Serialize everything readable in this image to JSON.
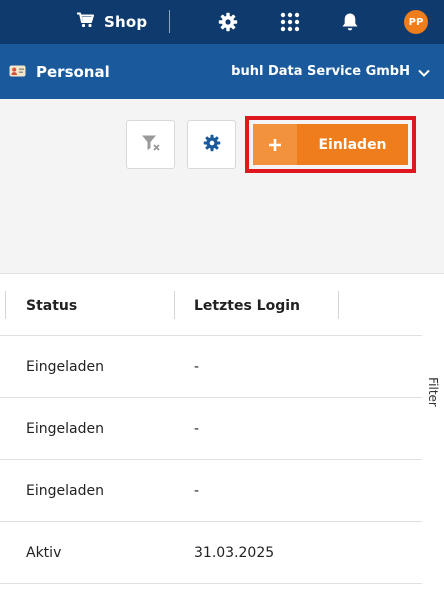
{
  "topbar": {
    "shop_label": "Shop",
    "user_initials": "PP",
    "avatar_color": "#f07d1b",
    "background": "#0e3a6e"
  },
  "subbar": {
    "title": "Personal",
    "company": "buhl Data Service GmbH",
    "background": "#1a5a9c"
  },
  "toolbar": {
    "invite_label": "Einladen",
    "invite_color": "#f07d1b",
    "highlight_color": "#e0171f"
  },
  "table": {
    "columns": [
      "Status",
      "Letztes Login"
    ],
    "rows": [
      [
        "Eingeladen",
        "-"
      ],
      [
        "Eingeladen",
        "-"
      ],
      [
        "Eingeladen",
        "-"
      ],
      [
        "Aktiv",
        "31.03.2025"
      ]
    ]
  },
  "filter_tab_label": "Filter"
}
